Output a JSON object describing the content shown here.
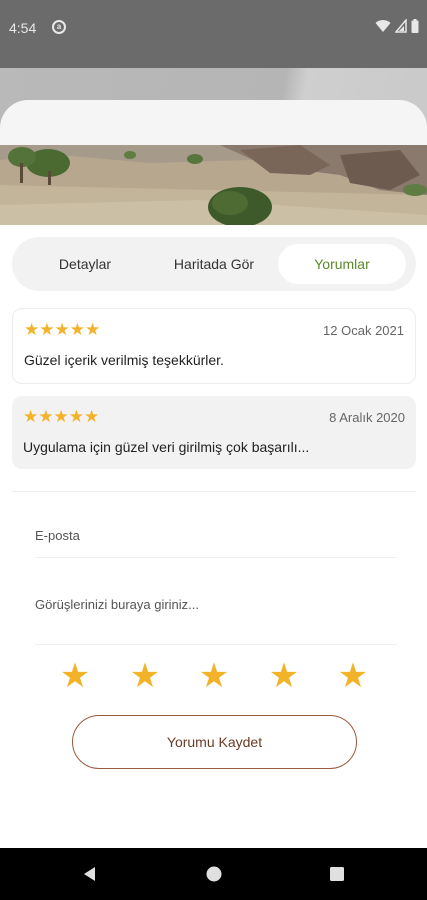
{
  "status_bar": {
    "time": "4:54",
    "icons": [
      "app-notification-icon",
      "wifi-icon",
      "signal-icon",
      "battery-icon"
    ]
  },
  "tabs": [
    {
      "label": "Detaylar",
      "active": false
    },
    {
      "label": "Haritada Gör",
      "active": false
    },
    {
      "label": "Yorumlar",
      "active": true
    }
  ],
  "reviews": [
    {
      "stars": "★★★★★",
      "rating": 5,
      "date": "12 Ocak 2021",
      "text": "Güzel içerik verilmiş teşekkürler."
    },
    {
      "stars": "★★★★★",
      "rating": 5,
      "date": "8 Aralık 2020",
      "text": "Uygulama için güzel veri girilmiş çok başarılı..."
    }
  ],
  "form": {
    "email_placeholder": "E-posta",
    "comment_placeholder": "Görüşlerinizi buraya giriniz...",
    "rating_stars": [
      "★",
      "★",
      "★",
      "★",
      "★"
    ],
    "save_label": "Yorumu Kaydet"
  },
  "colors": {
    "accent_green": "#5b8a2a",
    "star": "#f2b32a",
    "button_border": "#9a5a3e"
  },
  "nav_bar": {
    "buttons": [
      "back-icon",
      "home-icon",
      "recents-icon"
    ]
  }
}
